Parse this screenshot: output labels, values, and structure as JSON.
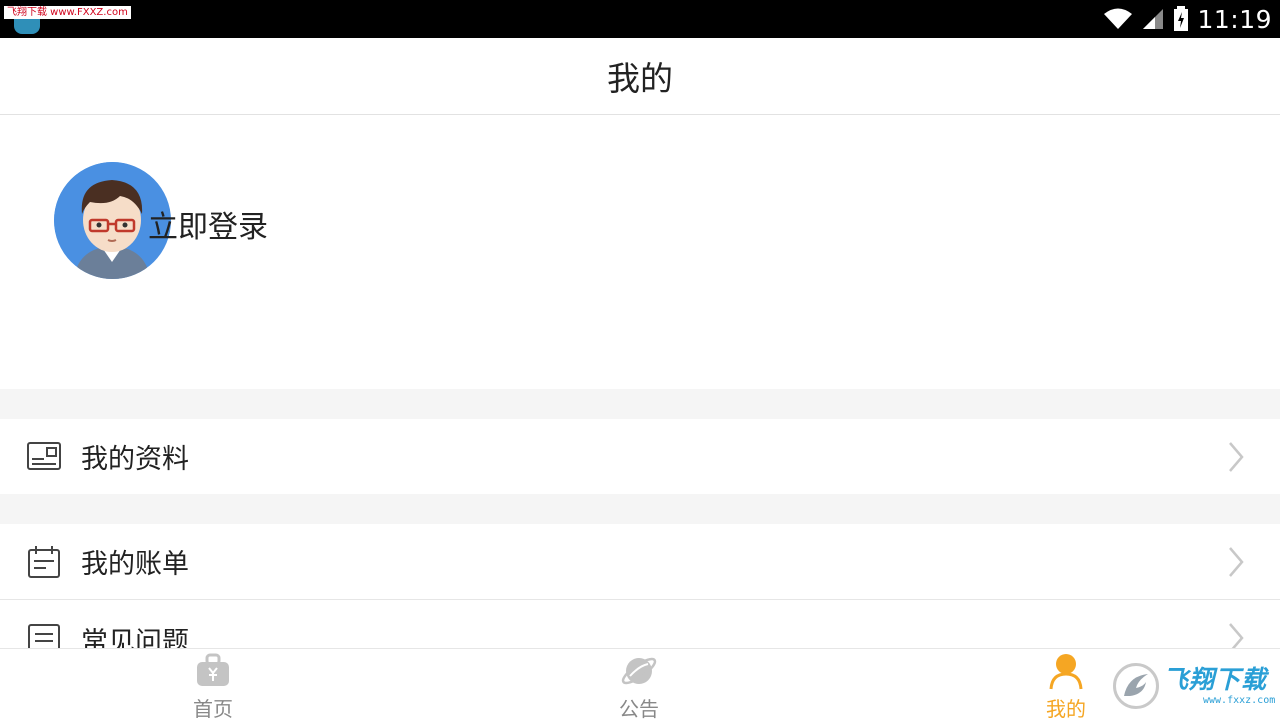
{
  "status_bar": {
    "watermark": "飞翔下载 www.FXXZ.com",
    "time": "11:19",
    "icons": [
      "wifi-icon",
      "signal-icon",
      "battery-icon"
    ]
  },
  "header": {
    "title": "我的"
  },
  "profile": {
    "login_label": "立即登录"
  },
  "menu": {
    "items": [
      {
        "label": "我的资料",
        "icon": "profile-card-icon"
      },
      {
        "label": "我的账单",
        "icon": "calendar-icon"
      },
      {
        "label": "常见问题",
        "icon": "document-icon"
      }
    ]
  },
  "bottom_nav": {
    "items": [
      {
        "label": "首页",
        "icon": "home-bag-icon",
        "active": false
      },
      {
        "label": "公告",
        "icon": "planet-icon",
        "active": false
      },
      {
        "label": "我的",
        "icon": "user-icon",
        "active": true
      }
    ]
  },
  "watermark": {
    "brand": "飞翔下载",
    "url": "www.fxxz.com"
  },
  "colors": {
    "accent": "#f5a623",
    "inactive": "#888888",
    "avatar_bg": "#4a90e2"
  }
}
